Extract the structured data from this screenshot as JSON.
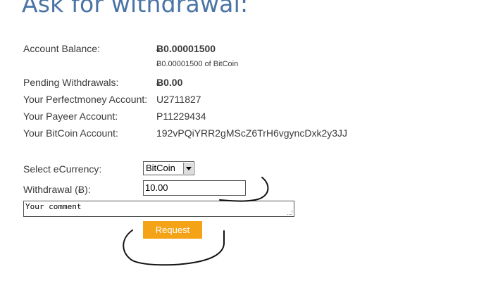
{
  "page": {
    "title": "Ask for withdrawal:"
  },
  "account": {
    "balance_label": "Account Balance:",
    "balance_value": "Ƀ0.00001500",
    "balance_note": "Ƀ0.00001500 of BitCoin",
    "pending_label": "Pending Withdrawals:",
    "pending_value": "Ƀ0.00",
    "perfectmoney_label": "Your Perfectmoney Account:",
    "perfectmoney_value": "U2711827",
    "payeer_label": "Your Payeer Account:",
    "payeer_value": "P11229434",
    "bitcoin_label": "Your BitCoin Account:",
    "bitcoin_value": "192vPQiYRR2gMScZ6TrH6vgyncDxk2y3JJ"
  },
  "form": {
    "currency_label": "Select eCurrency:",
    "currency_selected": "BitCoin",
    "withdrawal_label": "Withdrawal (Ƀ):",
    "withdrawal_value": "10.00",
    "comment_placeholder": "Your comment",
    "request_label": "Request"
  },
  "colors": {
    "title": "#4a74a5",
    "button": "#f5a316",
    "text": "#3a3a3a"
  }
}
